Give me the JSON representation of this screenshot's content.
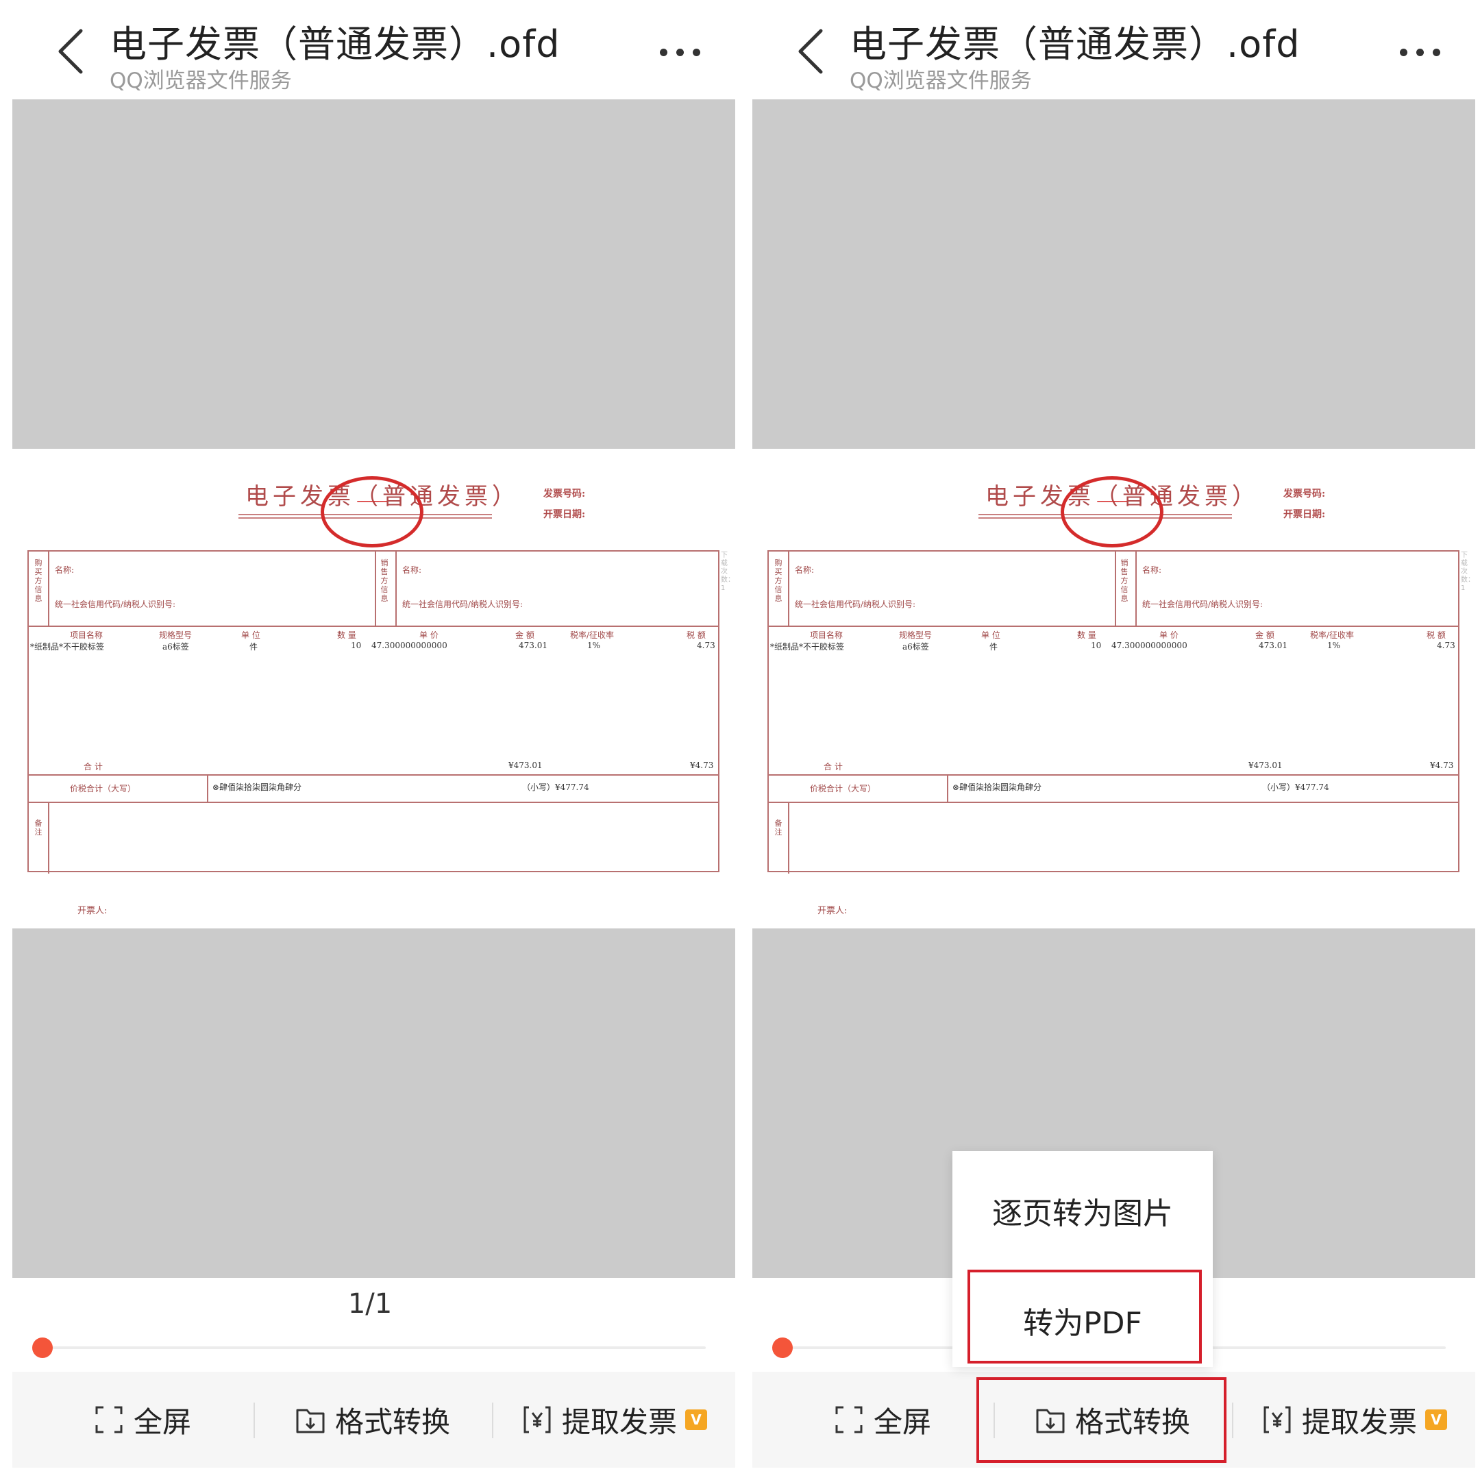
{
  "header": {
    "title": "电子发票（普通发票）.ofd",
    "subtitle": "QQ浏览器文件服务"
  },
  "invoice": {
    "title": "电子发票（普通发票）",
    "invoice_number_label": "发票号码:",
    "issue_date_label": "开票日期:",
    "buyer_label": "购买方信息",
    "seller_label": "销售方信息",
    "name_label": "名称:",
    "tax_id_label": "统一社会信用代码/纳税人识别号:",
    "columns": [
      "项目名称",
      "规格型号",
      "单 位",
      "数 量",
      "单 价",
      "金 额",
      "税率/征收率",
      "税 额"
    ],
    "row": [
      "*纸制品*不干胶标签",
      "a6标签",
      "件",
      "10",
      "47.300000000000",
      "473.01",
      "1%",
      "4.73"
    ],
    "total_label": "合 计",
    "total_amount": "¥473.01",
    "total_tax": "¥4.73",
    "grand_total_label": "价税合计（大写）",
    "grand_total_words": "⊗肆佰柒拾柒圆柒角肆分",
    "grand_total_small": "（小写）¥477.74",
    "remarks_label": "备注",
    "issuer_label": "开票人:",
    "side_note": "下载次数：1"
  },
  "viewer": {
    "page_indicator": "1/1",
    "progress": 0.0
  },
  "toolbar": {
    "fullscreen": "全屏",
    "convert": "格式转换",
    "extract": "提取发票",
    "vip_badge": "V"
  },
  "popup": {
    "item_images": "逐页转为图片",
    "item_pdf": "转为PDF"
  },
  "colors": {
    "accent": "#f4553a",
    "highlight": "#d51f2b",
    "seal": "#d42b2b",
    "viewer_bg": "#cbcbcb"
  },
  "icons": {
    "back": "chevron-left-icon",
    "more": "more-dots-icon",
    "fullscreen": "fullscreen-icon",
    "convert": "folder-download-icon",
    "extract": "yuan-scan-icon"
  }
}
